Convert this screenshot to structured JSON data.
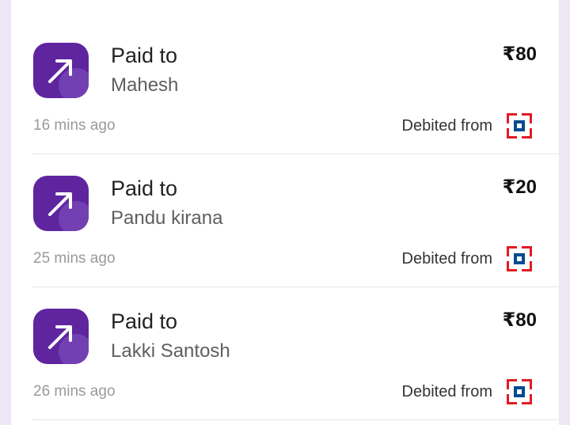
{
  "transactions": [
    {
      "title": "Paid to",
      "name": "Mahesh",
      "amount": "₹80",
      "time": "16 mins ago",
      "debit_label": "Debited from",
      "direction_icon": "arrow-up-right-icon",
      "bank_icon": "hdfc-bank-logo-icon"
    },
    {
      "title": "Paid to",
      "name": "Pandu kirana",
      "amount": "₹20",
      "time": "25 mins ago",
      "debit_label": "Debited from",
      "direction_icon": "arrow-up-right-icon",
      "bank_icon": "hdfc-bank-logo-icon"
    },
    {
      "title": "Paid to",
      "name": "Lakki Santosh",
      "amount": "₹80",
      "time": "26 mins ago",
      "debit_label": "Debited from",
      "direction_icon": "arrow-up-right-icon",
      "bank_icon": "hdfc-bank-logo-icon"
    }
  ],
  "colors": {
    "background": "#ece6f5",
    "card": "#ffffff",
    "icon_tile": "#5f259f",
    "bank_red": "#e31b23",
    "bank_blue": "#004c8f"
  }
}
